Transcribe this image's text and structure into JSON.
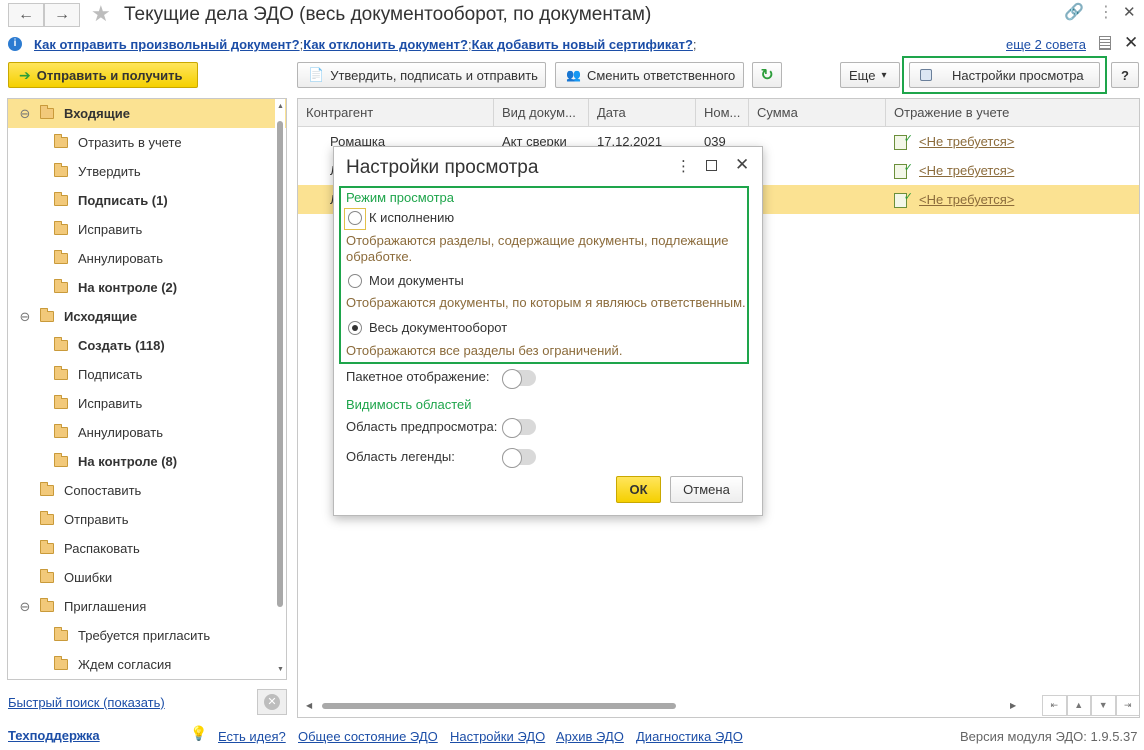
{
  "window": {
    "title": "Текущие дела ЭДО (весь документооборот, по документам)",
    "back_glyph": "←",
    "forward_glyph": "→",
    "star_glyph": "★",
    "link_glyph": "🔗",
    "menu_glyph": "⋮",
    "maximize_glyph": "☐",
    "close_glyph": "✕"
  },
  "hints": {
    "info_glyph": "i",
    "links": [
      "Как отправить произвольный документ?",
      "Как отклонить документ?",
      "Как добавить новый сертификат?"
    ],
    "separator": ";",
    "more": "еще 2 совета",
    "close_glyph": "✕"
  },
  "toolbar": {
    "send_receive": "Отправить и получить",
    "approve_sign_send": "Утвердить, подписать и отправить",
    "change_responsible": "Сменить ответственного",
    "refresh_glyph": "↻",
    "more": "Еще",
    "more_arrow": "▾",
    "view_settings": "Настройки просмотра",
    "help": "?"
  },
  "tree": {
    "items": [
      {
        "label": "Входящие",
        "bold": true,
        "level": 0,
        "expanded": true,
        "selected": true
      },
      {
        "label": "Отразить в учете",
        "bold": false,
        "level": 1
      },
      {
        "label": "Утвердить",
        "bold": false,
        "level": 1
      },
      {
        "label": "Подписать (1)",
        "bold": true,
        "level": 1
      },
      {
        "label": "Исправить",
        "bold": false,
        "level": 1
      },
      {
        "label": "Аннулировать",
        "bold": false,
        "level": 1
      },
      {
        "label": "На контроле (2)",
        "bold": true,
        "level": 1
      },
      {
        "label": "Исходящие",
        "bold": true,
        "level": 0,
        "expanded": true
      },
      {
        "label": "Создать (118)",
        "bold": true,
        "level": 1
      },
      {
        "label": "Подписать",
        "bold": false,
        "level": 1
      },
      {
        "label": "Исправить",
        "bold": false,
        "level": 1
      },
      {
        "label": "Аннулировать",
        "bold": false,
        "level": 1
      },
      {
        "label": "На контроле (8)",
        "bold": true,
        "level": 1
      },
      {
        "label": "Сопоставить",
        "bold": false,
        "level": 0
      },
      {
        "label": "Отправить",
        "bold": false,
        "level": 0
      },
      {
        "label": "Распаковать",
        "bold": false,
        "level": 0
      },
      {
        "label": "Ошибки",
        "bold": false,
        "level": 0
      },
      {
        "label": "Приглашения",
        "bold": false,
        "level": 0,
        "expanded": true
      },
      {
        "label": "Требуется пригласить",
        "bold": false,
        "level": 1
      },
      {
        "label": "Ждем согласия",
        "bold": false,
        "level": 1
      }
    ],
    "minus_glyph": "⊖"
  },
  "table": {
    "columns": [
      "Контрагент",
      "Вид докум...",
      "Дата",
      "Ном...",
      "Сумма",
      "Отражение в учете"
    ],
    "rows": [
      {
        "counterparty": "Ромашка",
        "doc_type": "Акт сверки",
        "date": "17.12.2021",
        "number": "039",
        "amount": "",
        "accounting": "<Не требуется>",
        "selected": false
      },
      {
        "counterparty": "Л",
        "doc_type": "",
        "date": "",
        "number": "",
        "amount": "",
        "accounting": "<Не требуется>",
        "selected": false
      },
      {
        "counterparty": "Л",
        "doc_type": "",
        "date": "",
        "number": "",
        "amount": "",
        "accounting": "<Не требуется>",
        "selected": true
      }
    ]
  },
  "quick_search": "Быстрый поиск (показать)",
  "dialog": {
    "title": "Настройки просмотра",
    "mode_label": "Режим просмотра",
    "options": [
      {
        "label": "К исполнению",
        "desc": "Отображаются разделы, содержащие документы, подлежащие обработке.",
        "checked": false
      },
      {
        "label": "Мои документы",
        "desc": "Отображаются документы, по которым я являюсь ответственным.",
        "checked": false
      },
      {
        "label": "Весь документооборот",
        "desc": "Отображаются все разделы без ограничений.",
        "checked": true
      }
    ],
    "batch_display": "Пакетное отображение:",
    "visibility_label": "Видимость областей",
    "preview_area": "Область предпросмотра:",
    "legend_area": "Область легенды:",
    "ok": "ОК",
    "cancel": "Отмена"
  },
  "footer": {
    "support": "Техподдержка",
    "bulb_glyph": "💡",
    "links": [
      "Есть идея?",
      "Общее состояние ЭДО",
      "Настройки ЭДО",
      "Архив ЭДО",
      "Диагностика ЭДО"
    ],
    "version": "Версия модуля ЭДО: 1.9.5.37"
  },
  "colors": {
    "accent_yellow": "#f5d000",
    "selection": "#fbe292",
    "highlight_green": "#1ea54b",
    "link_blue": "#1c4ea7"
  }
}
